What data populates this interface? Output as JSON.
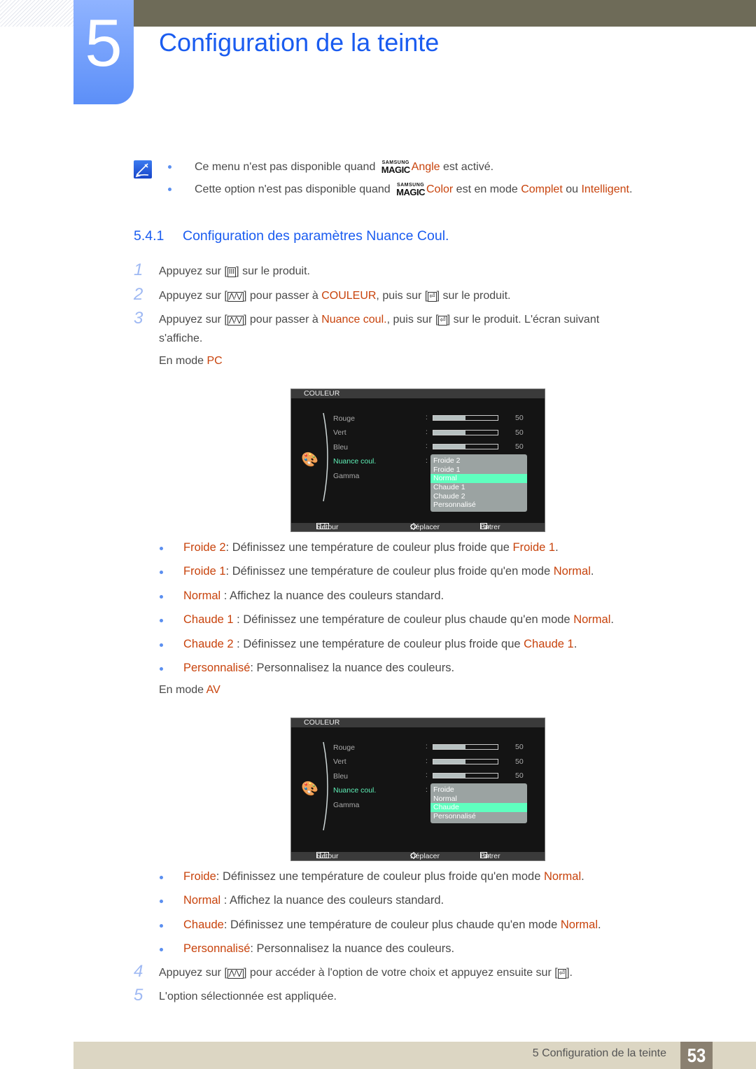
{
  "chapter": {
    "number": "5",
    "title": "Configuration de la teinte"
  },
  "notes": [
    {
      "pre": "Ce menu n'est pas disponible quand",
      "logo_top": "SAMSUNG",
      "logo_bottom": "MAGIC",
      "hl1": "Angle",
      "mid": " est activé.",
      "hl2": "",
      "mid2": "",
      "hl3": "",
      "end": ""
    },
    {
      "pre": "Cette option n'est pas disponible quand",
      "logo_top": "SAMSUNG",
      "logo_bottom": "MAGIC",
      "hl1": "Color",
      "mid": " est en mode ",
      "hl2": "Complet",
      "mid2": " ou ",
      "hl3": "Intelligent",
      "end": "."
    }
  ],
  "section": {
    "number": "5.4.1",
    "title": "Configuration des paramètres Nuance Coul."
  },
  "steps": [
    {
      "num": "1",
      "a": "Appuyez sur [",
      "key1": "III",
      "b": "] sur le produit.",
      "hl": "",
      "c": "",
      "key2": "",
      "d": ""
    },
    {
      "num": "2",
      "a": "Appuyez sur [",
      "key1": "⋀/⋁",
      "b": "] pour passer à ",
      "hl": "COULEUR",
      "c": ", puis sur [",
      "key2": "⏎",
      "d": "] sur le produit."
    },
    {
      "num": "3",
      "a": "Appuyez sur [",
      "key1": "⋀/⋁",
      "b": "] pour passer à ",
      "hl": "Nuance coul.",
      "c": ", puis sur [",
      "key2": "⏎",
      "d": "] sur le produit. L'écran suivant",
      "cont": "s'affiche."
    },
    {
      "num": "4",
      "a": "Appuyez sur [",
      "key1": "⋀/⋁",
      "b": "] pour accéder à l'option de votre choix et appuyez ensuite sur [",
      "key2": "⏎",
      "d": "]."
    },
    {
      "num": "5",
      "a": "L'option sélectionnée est appliquée."
    }
  ],
  "mode_pc": {
    "prefix": "En mode ",
    "mode": "PC"
  },
  "mode_av": {
    "prefix": "En mode ",
    "mode": "AV"
  },
  "osd_pc": {
    "header": "COULEUR",
    "items": [
      "Rouge",
      "Vert",
      "Bleu",
      "Nuance coul.",
      "Gamma"
    ],
    "sliders": [
      {
        "label": "Rouge",
        "value": "50",
        "fraction": 0.5
      },
      {
        "label": "Vert",
        "value": "50",
        "fraction": 0.5
      },
      {
        "label": "Bleu",
        "value": "50",
        "fraction": 0.5
      }
    ],
    "options": [
      "Froide 2",
      "Froide 1",
      "Normal",
      "Chaude 1",
      "Chaude 2",
      "Personnalisé"
    ],
    "selected": "Normal",
    "footer": {
      "back": "Retour",
      "move": "Déplacer",
      "enter": "Entrer"
    }
  },
  "osd_av": {
    "header": "COULEUR",
    "items": [
      "Rouge",
      "Vert",
      "Bleu",
      "Nuance coul.",
      "Gamma"
    ],
    "sliders": [
      {
        "label": "Rouge",
        "value": "50",
        "fraction": 0.5
      },
      {
        "label": "Vert",
        "value": "50",
        "fraction": 0.5
      },
      {
        "label": "Bleu",
        "value": "50",
        "fraction": 0.5
      }
    ],
    "options": [
      "Froide",
      "Normal",
      "Chaude",
      "Personnalisé"
    ],
    "selected": "Chaude",
    "footer": {
      "back": "Retour",
      "move": "Déplacer",
      "enter": "Entrer"
    }
  },
  "desc_pc": [
    {
      "term": "Froide 2",
      "text": ": Définissez une température de couleur plus froide que ",
      "ref": "Froide 1",
      "end": "."
    },
    {
      "term": "Froide 1",
      "text": ": Définissez une température de couleur plus froide qu'en mode ",
      "ref": "Normal",
      "end": "."
    },
    {
      "term": "Normal",
      "text": " : Affichez la nuance des couleurs standard.",
      "ref": "",
      "end": ""
    },
    {
      "term": "Chaude 1",
      "text": " : Définissez une température de couleur plus chaude qu'en mode ",
      "ref": "Normal",
      "end": "."
    },
    {
      "term": "Chaude 2",
      "text": " : Définissez une température de couleur plus froide que ",
      "ref": "Chaude 1",
      "end": "."
    },
    {
      "term": "Personnalisé",
      "text": ": Personnalisez la nuance des couleurs.",
      "ref": "",
      "end": ""
    }
  ],
  "desc_av": [
    {
      "term": "Froide",
      "text": ": Définissez une température de couleur plus froide qu'en mode ",
      "ref": "Normal",
      "end": "."
    },
    {
      "term": "Normal",
      "text": " : Affichez la nuance des couleurs standard.",
      "ref": "",
      "end": ""
    },
    {
      "term": "Chaude",
      "text": ": Définissez une température de couleur plus chaude qu'en mode ",
      "ref": "Normal",
      "end": "."
    },
    {
      "term": "Personnalisé",
      "text": ": Personnalisez la nuance des couleurs.",
      "ref": "",
      "end": ""
    }
  ],
  "footer": {
    "text": "5 Configuration de la teinte",
    "page": "53"
  },
  "colors": {
    "accent_blue": "#1a5cf0",
    "highlight": "#c8430c",
    "osd_selected": "#5fffbf"
  }
}
